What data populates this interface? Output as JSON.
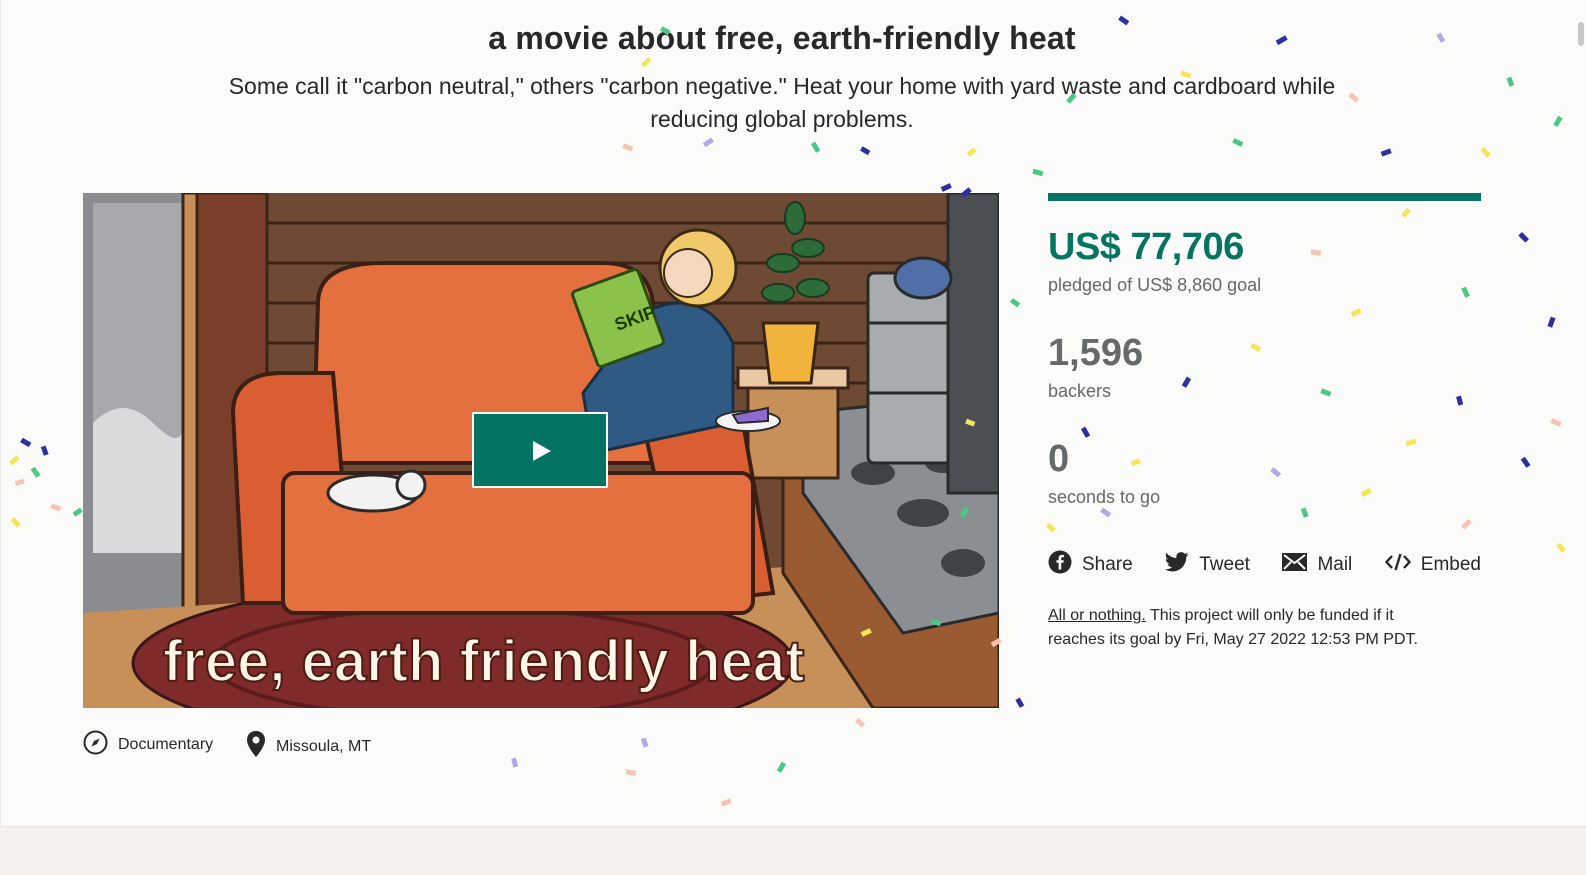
{
  "project": {
    "title": "a movie about free, earth-friendly heat",
    "blurb": "Some call it \"carbon neutral,\" others \"carbon negative.\" Heat your home with yard waste and cardboard while reducing global problems."
  },
  "video": {
    "caption": "free, earth friendly heat",
    "book_title": "SKIP"
  },
  "meta": {
    "category": "Documentary",
    "location": "Missoula, MT"
  },
  "stats": {
    "progress_percent": 100,
    "pledged_amount": "US$ 77,706",
    "pledged_label": "pledged of US$ 8,860 goal",
    "backers_count": "1,596",
    "backers_label": "backers",
    "seconds_count": "0",
    "seconds_label": "seconds to go"
  },
  "share": {
    "share_label": "Share",
    "tweet_label": "Tweet",
    "mail_label": "Mail",
    "embed_label": "Embed"
  },
  "funding_note": {
    "link_text": "All or nothing.",
    "text": " This project will only be funded if it reaches its goal by Fri, May 27 2022 12:53 PM PDT."
  },
  "colors": {
    "accent": "#037362",
    "muted": "#656969",
    "text": "#282828"
  }
}
